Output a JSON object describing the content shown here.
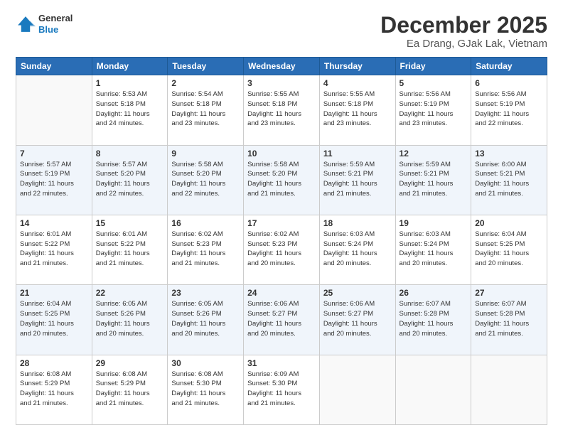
{
  "header": {
    "logo": {
      "line1": "General",
      "line2": "Blue"
    },
    "title": "December 2025",
    "subtitle": "Ea Drang, GJak Lak, Vietnam"
  },
  "weekdays": [
    "Sunday",
    "Monday",
    "Tuesday",
    "Wednesday",
    "Thursday",
    "Friday",
    "Saturday"
  ],
  "weeks": [
    [
      {
        "day": "",
        "info": ""
      },
      {
        "day": "1",
        "info": "Sunrise: 5:53 AM\nSunset: 5:18 PM\nDaylight: 11 hours\nand 24 minutes."
      },
      {
        "day": "2",
        "info": "Sunrise: 5:54 AM\nSunset: 5:18 PM\nDaylight: 11 hours\nand 23 minutes."
      },
      {
        "day": "3",
        "info": "Sunrise: 5:55 AM\nSunset: 5:18 PM\nDaylight: 11 hours\nand 23 minutes."
      },
      {
        "day": "4",
        "info": "Sunrise: 5:55 AM\nSunset: 5:18 PM\nDaylight: 11 hours\nand 23 minutes."
      },
      {
        "day": "5",
        "info": "Sunrise: 5:56 AM\nSunset: 5:19 PM\nDaylight: 11 hours\nand 23 minutes."
      },
      {
        "day": "6",
        "info": "Sunrise: 5:56 AM\nSunset: 5:19 PM\nDaylight: 11 hours\nand 22 minutes."
      }
    ],
    [
      {
        "day": "7",
        "info": "Sunrise: 5:57 AM\nSunset: 5:19 PM\nDaylight: 11 hours\nand 22 minutes."
      },
      {
        "day": "8",
        "info": "Sunrise: 5:57 AM\nSunset: 5:20 PM\nDaylight: 11 hours\nand 22 minutes."
      },
      {
        "day": "9",
        "info": "Sunrise: 5:58 AM\nSunset: 5:20 PM\nDaylight: 11 hours\nand 22 minutes."
      },
      {
        "day": "10",
        "info": "Sunrise: 5:58 AM\nSunset: 5:20 PM\nDaylight: 11 hours\nand 21 minutes."
      },
      {
        "day": "11",
        "info": "Sunrise: 5:59 AM\nSunset: 5:21 PM\nDaylight: 11 hours\nand 21 minutes."
      },
      {
        "day": "12",
        "info": "Sunrise: 5:59 AM\nSunset: 5:21 PM\nDaylight: 11 hours\nand 21 minutes."
      },
      {
        "day": "13",
        "info": "Sunrise: 6:00 AM\nSunset: 5:21 PM\nDaylight: 11 hours\nand 21 minutes."
      }
    ],
    [
      {
        "day": "14",
        "info": "Sunrise: 6:01 AM\nSunset: 5:22 PM\nDaylight: 11 hours\nand 21 minutes."
      },
      {
        "day": "15",
        "info": "Sunrise: 6:01 AM\nSunset: 5:22 PM\nDaylight: 11 hours\nand 21 minutes."
      },
      {
        "day": "16",
        "info": "Sunrise: 6:02 AM\nSunset: 5:23 PM\nDaylight: 11 hours\nand 21 minutes."
      },
      {
        "day": "17",
        "info": "Sunrise: 6:02 AM\nSunset: 5:23 PM\nDaylight: 11 hours\nand 20 minutes."
      },
      {
        "day": "18",
        "info": "Sunrise: 6:03 AM\nSunset: 5:24 PM\nDaylight: 11 hours\nand 20 minutes."
      },
      {
        "day": "19",
        "info": "Sunrise: 6:03 AM\nSunset: 5:24 PM\nDaylight: 11 hours\nand 20 minutes."
      },
      {
        "day": "20",
        "info": "Sunrise: 6:04 AM\nSunset: 5:25 PM\nDaylight: 11 hours\nand 20 minutes."
      }
    ],
    [
      {
        "day": "21",
        "info": "Sunrise: 6:04 AM\nSunset: 5:25 PM\nDaylight: 11 hours\nand 20 minutes."
      },
      {
        "day": "22",
        "info": "Sunrise: 6:05 AM\nSunset: 5:26 PM\nDaylight: 11 hours\nand 20 minutes."
      },
      {
        "day": "23",
        "info": "Sunrise: 6:05 AM\nSunset: 5:26 PM\nDaylight: 11 hours\nand 20 minutes."
      },
      {
        "day": "24",
        "info": "Sunrise: 6:06 AM\nSunset: 5:27 PM\nDaylight: 11 hours\nand 20 minutes."
      },
      {
        "day": "25",
        "info": "Sunrise: 6:06 AM\nSunset: 5:27 PM\nDaylight: 11 hours\nand 20 minutes."
      },
      {
        "day": "26",
        "info": "Sunrise: 6:07 AM\nSunset: 5:28 PM\nDaylight: 11 hours\nand 20 minutes."
      },
      {
        "day": "27",
        "info": "Sunrise: 6:07 AM\nSunset: 5:28 PM\nDaylight: 11 hours\nand 21 minutes."
      }
    ],
    [
      {
        "day": "28",
        "info": "Sunrise: 6:08 AM\nSunset: 5:29 PM\nDaylight: 11 hours\nand 21 minutes."
      },
      {
        "day": "29",
        "info": "Sunrise: 6:08 AM\nSunset: 5:29 PM\nDaylight: 11 hours\nand 21 minutes."
      },
      {
        "day": "30",
        "info": "Sunrise: 6:08 AM\nSunset: 5:30 PM\nDaylight: 11 hours\nand 21 minutes."
      },
      {
        "day": "31",
        "info": "Sunrise: 6:09 AM\nSunset: 5:30 PM\nDaylight: 11 hours\nand 21 minutes."
      },
      {
        "day": "",
        "info": ""
      },
      {
        "day": "",
        "info": ""
      },
      {
        "day": "",
        "info": ""
      }
    ]
  ]
}
